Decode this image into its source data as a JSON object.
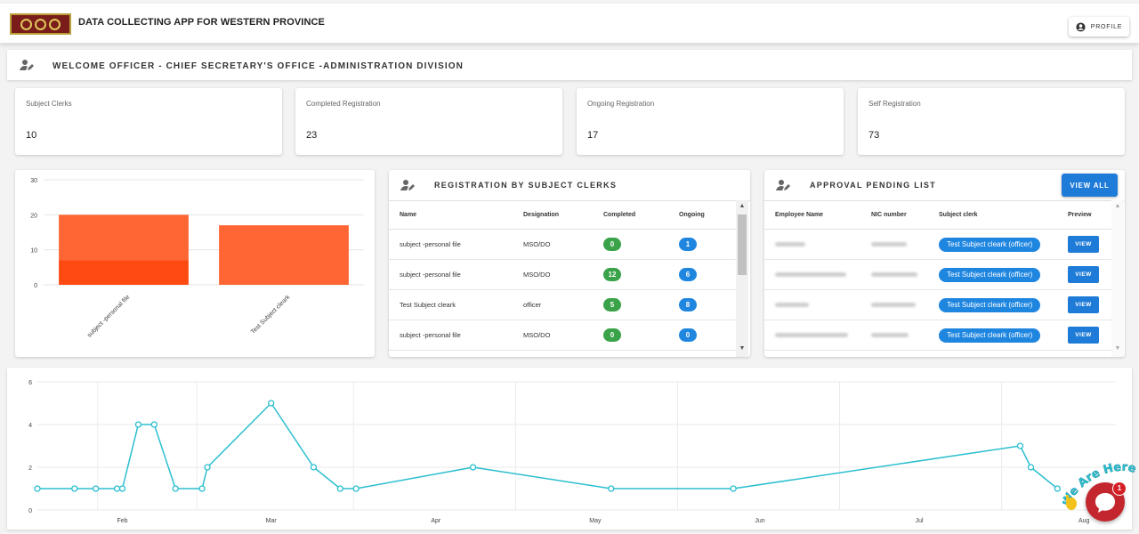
{
  "header": {
    "app_title": "DATA COLLECTING APP FOR WESTERN PROVINCE",
    "profile_label": "PROFILE"
  },
  "welcome": {
    "text": "WELCOME OFFICER - CHIEF SECRETARY'S OFFICE -ADMINISTRATION DIVISION"
  },
  "stats": [
    {
      "label": "Subject Clerks",
      "value": "10"
    },
    {
      "label": "Completed Registration",
      "value": "23"
    },
    {
      "label": "Ongoing Registration",
      "value": "17"
    },
    {
      "label": "Self Registration",
      "value": "73"
    }
  ],
  "registration_card": {
    "title": "REGISTRATION BY SUBJECT CLERKS",
    "columns": [
      "Name",
      "Designation",
      "Completed",
      "Ongoing"
    ],
    "rows": [
      {
        "name": "subject -personal file",
        "designation": "MSO/DO",
        "completed": "0",
        "ongoing": "1"
      },
      {
        "name": "subject -personal file",
        "designation": "MSO/DO",
        "completed": "12",
        "ongoing": "6"
      },
      {
        "name": "Test Subject cleark",
        "designation": "officer",
        "completed": "5",
        "ongoing": "8"
      },
      {
        "name": "subject -personal file",
        "designation": "MSO/DO",
        "completed": "0",
        "ongoing": "0"
      }
    ]
  },
  "approval_card": {
    "title": "APPROVAL PENDING LIST",
    "view_all_label": "VIEW ALL",
    "columns": [
      "Employee Name",
      "NIC number",
      "Subject clerk",
      "Preview"
    ],
    "rows": [
      {
        "subject_clerk": "Test Subject cleark (officer)",
        "preview_label": "VIEW"
      },
      {
        "subject_clerk": "Test Subject cleark (officer)",
        "preview_label": "VIEW"
      },
      {
        "subject_clerk": "Test Subject cleark (officer)",
        "preview_label": "VIEW"
      },
      {
        "subject_clerk": "Test Subject cleark (officer)",
        "preview_label": "VIEW"
      }
    ]
  },
  "chart_data": [
    {
      "type": "bar",
      "categories": [
        "subject -personal file",
        "Test Subject cleark"
      ],
      "series": [
        {
          "values": [
            7,
            0
          ],
          "color": "#ff4a12"
        },
        {
          "values": [
            13,
            17
          ],
          "color": "#ff6633"
        }
      ],
      "stacked": true,
      "ylim": [
        0,
        30
      ],
      "yticks": [
        "0",
        "10",
        "20",
        "30"
      ],
      "grid": true
    },
    {
      "type": "line",
      "color": "#2bbfcf",
      "ylim": [
        0,
        6
      ],
      "yticks": [
        "0",
        "2",
        "4",
        "6"
      ],
      "xlim": [
        "2023-01-16",
        "2023-08-07"
      ],
      "xticks": [
        {
          "label": "Feb",
          "date": "2023-02-01"
        },
        {
          "label": "Mar",
          "date": "2023-03-01"
        },
        {
          "label": "Apr",
          "date": "2023-04-01"
        },
        {
          "label": "May",
          "date": "2023-05-01"
        },
        {
          "label": "Jun",
          "date": "2023-06-01"
        },
        {
          "label": "Jul",
          "date": "2023-07-01"
        },
        {
          "label": "Aug",
          "date": "2023-08-01"
        }
      ],
      "grid": true,
      "points": [
        {
          "x": "2023-01-16",
          "y": 1
        },
        {
          "x": "2023-01-23",
          "y": 1
        },
        {
          "x": "2023-01-27",
          "y": 1
        },
        {
          "x": "2023-01-31",
          "y": 1
        },
        {
          "x": "2023-02-01",
          "y": 1
        },
        {
          "x": "2023-02-04",
          "y": 4
        },
        {
          "x": "2023-02-07",
          "y": 4
        },
        {
          "x": "2023-02-11",
          "y": 1
        },
        {
          "x": "2023-02-16",
          "y": 1
        },
        {
          "x": "2023-02-17",
          "y": 2
        },
        {
          "x": "2023-03-01",
          "y": 5
        },
        {
          "x": "2023-03-09",
          "y": 2
        },
        {
          "x": "2023-03-14",
          "y": 1
        },
        {
          "x": "2023-03-17",
          "y": 1
        },
        {
          "x": "2023-04-08",
          "y": 2
        },
        {
          "x": "2023-05-04",
          "y": 1
        },
        {
          "x": "2023-05-27",
          "y": 1
        },
        {
          "x": "2023-07-20",
          "y": 3
        },
        {
          "x": "2023-07-22",
          "y": 2
        },
        {
          "x": "2023-07-27",
          "y": 1
        }
      ]
    }
  ],
  "chat_widget": {
    "banner_text": "We Are Here!",
    "badge_count": "1"
  }
}
